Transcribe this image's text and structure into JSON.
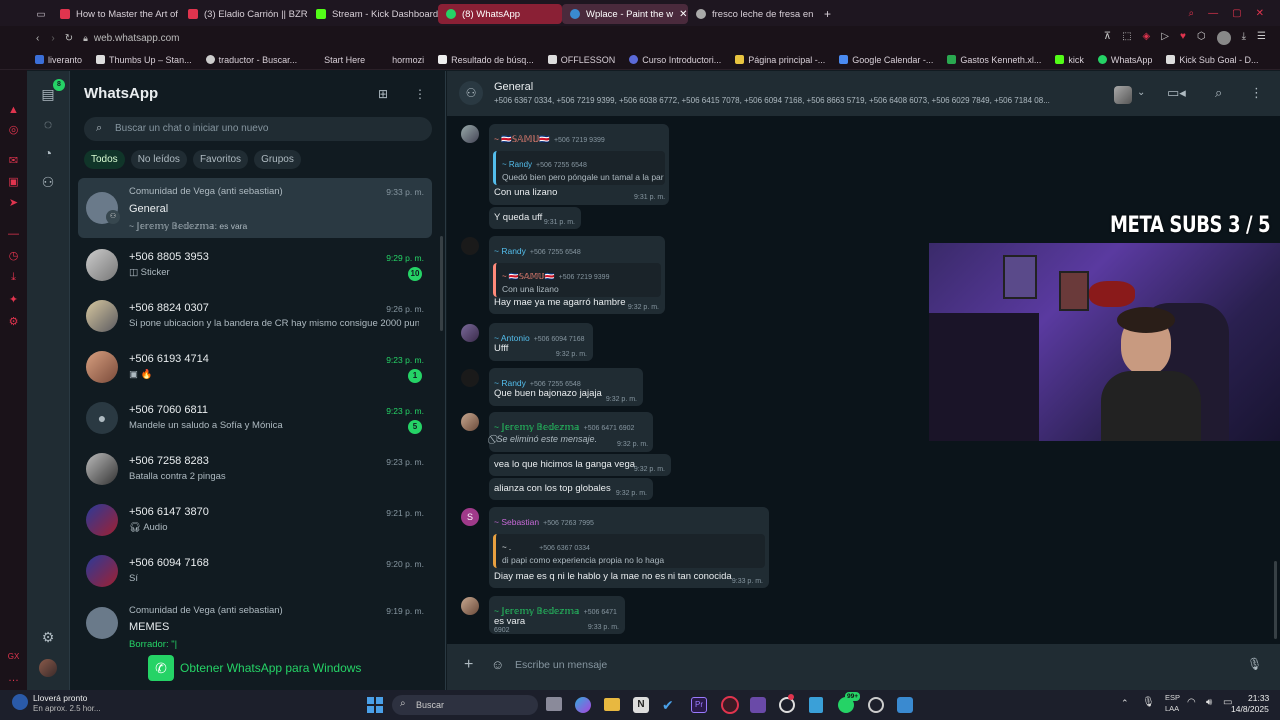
{
  "browser": {
    "tabs": [
      {
        "label": "How to Master the Art of",
        "color": "#e0344e"
      },
      {
        "label": "(3) Eladio Carrión || BZRP",
        "color": "#e0344e"
      },
      {
        "label": "Stream - Kick Dashboard",
        "color": "#53fc18"
      },
      {
        "label": "(8) WhatsApp",
        "color": "#25d366"
      },
      {
        "label": "Wplace - Paint the w",
        "color": "#3a8ad0"
      },
      {
        "label": "fresco leche de fresa en",
        "color": "#aaaaaa"
      }
    ],
    "url": "web.whatsapp.com",
    "bookmarks": [
      "liveranto",
      "Thumbs Up – Stan...",
      "traductor - Buscar...",
      "Start Here",
      "hormozi",
      "Resultado de búsq...",
      "OFFLESSON",
      "Curso Introductori...",
      "Página principal -...",
      "Google Calendar -...",
      "Gastos Kenneth.xl...",
      "kick",
      "WhatsApp",
      "Kick Sub Goal - D..."
    ]
  },
  "rail": {
    "badge": "8"
  },
  "sidebar": {
    "title": "WhatsApp",
    "search_placeholder": "Buscar un chat o iniciar uno nuevo",
    "filters": [
      "Todos",
      "No leídos",
      "Favoritos",
      "Grupos"
    ],
    "get_app": "Obtener WhatsApp para Windows"
  },
  "chats": [
    {
      "group": "Comunidad de Vega (anti sebastian)",
      "name": "General",
      "preview": "~ 𝕁𝕖𝕣𝕖𝕞𝕪 𝔹𝕖𝕕𝕖𝕫𝕞𝕒: es vara",
      "time": "9:33 p. m.",
      "unread": "",
      "green": false
    },
    {
      "name": "+506 8805 3953",
      "preview": "Sticker",
      "time": "9:29 p. m.",
      "unread": "10",
      "green": true
    },
    {
      "name": "+506 8824 0307",
      "preview": "Si pone ubicacion y la bandera de CR hay mismo consigue 2000 pun...",
      "time": "9:26 p. m.",
      "unread": "",
      "green": false
    },
    {
      "name": "+506 6193 4714",
      "preview": "🔥",
      "time": "9:23 p. m.",
      "unread": "1",
      "green": true
    },
    {
      "name": "+506 7060 6811",
      "preview": "Mandele un saludo a Sofía y Mónica",
      "time": "9:23 p. m.",
      "unread": "5",
      "green": true
    },
    {
      "name": "+506 7258 8283",
      "preview": "Batalla contra 2 pingas",
      "time": "9:23 p. m.",
      "unread": "",
      "green": false
    },
    {
      "name": "+506 6147 3870",
      "preview": "Audio",
      "time": "9:21 p. m.",
      "unread": "",
      "green": false
    },
    {
      "name": "+506 6094 7168",
      "preview": "Sí",
      "time": "9:20 p. m.",
      "unread": "",
      "green": false
    },
    {
      "group": "Comunidad de Vega (anti sebastian)",
      "name": "MEMES",
      "preview": "Borrador: \"|",
      "time": "9:19 p. m.",
      "unread": "",
      "green": false
    }
  ],
  "chat": {
    "title": "General",
    "members": "+506 6367 0334, +506 7219 9399, +506 6038 6772, +506 6415 7078, +506 6094 7168, +506 8663 5719, +506 6408 6073, +506 6029 7849, +506 7184 08...",
    "compose_placeholder": "Escribe un mensaje"
  },
  "messages": {
    "m1": {
      "author": "~ 🇨🇷𝕊𝔸𝕄𝕌🇨🇷",
      "phone": "+506 7219 9399",
      "q_author": "~ Randy",
      "q_phone": "+506 7255 6548",
      "q_text": "Quedó bien pero póngale un tamal a la par"
    },
    "m2": {
      "text": "Con una lizano",
      "time": "9:31 p. m."
    },
    "m3": {
      "text": "Y queda uff",
      "time": "9:31 p. m."
    },
    "m4": {
      "author": "~ Randy",
      "phone": "+506 7255 6548",
      "q_author": "~ 🇨🇷𝕊𝔸𝕄𝕌🇨🇷",
      "q_phone": "+506 7219 9399",
      "q_text": "Con una lizano",
      "text": "Hay mae ya me agarró hambre",
      "time": "9:32 p. m."
    },
    "m5": {
      "author": "~ Antonio",
      "phone": "+506 6094 7168",
      "text": "Ufff",
      "time": "9:32 p. m."
    },
    "m6": {
      "author": "~ Randy",
      "phone": "+506 7255 6548",
      "text": "Que buen bajonazo jajaja",
      "time": "9:32 p. m."
    },
    "m7": {
      "author": "~ 𝕁𝕖𝕣𝕖𝕞𝕪 𝔹𝕖𝕕𝕖𝕫𝕞𝕒",
      "phone": "+506 6471 6902",
      "text": "Se eliminó este mensaje.",
      "time": "9:32 p. m."
    },
    "m8": {
      "text": "vea lo que hicimos la ganga vega",
      "time": "9:32 p. m."
    },
    "m9": {
      "text": "alianza con los top globales",
      "time": "9:32 p. m."
    },
    "m10": {
      "author": "~ Sebastian",
      "phone": "+506 7263 7995",
      "avatar_letter": "S",
      "q_author": "~ .",
      "q_phone": "+506 6367 0334",
      "q_text": "di papi como experiencia propia no lo haga",
      "text": "Diay mae es q ni le hablo y la mae no es ni tan conocida",
      "time": "9:33 p. m."
    },
    "m11": {
      "author": "~ 𝕁𝕖𝕣𝕖𝕞𝕪 𝔹𝕖𝕕𝕖𝕫𝕞𝕒",
      "phone": "+506 6471 6902",
      "text": "es vara",
      "time": "9:33 p. m."
    }
  },
  "overlay": {
    "meta_subs": "META SUBS  3 / 5"
  },
  "taskbar": {
    "weather_title": "Lloverá pronto",
    "weather_sub": "En aprox. 2.5 hor...",
    "search": "Buscar",
    "lang1": "ESP",
    "lang2": "LAA",
    "time": "21:33",
    "date": "14/8/2025",
    "badge": "99+"
  },
  "colors": {
    "accent": "#25d366",
    "bg": "#111b21",
    "panel": "#202c33",
    "opera": "#e0344e"
  }
}
